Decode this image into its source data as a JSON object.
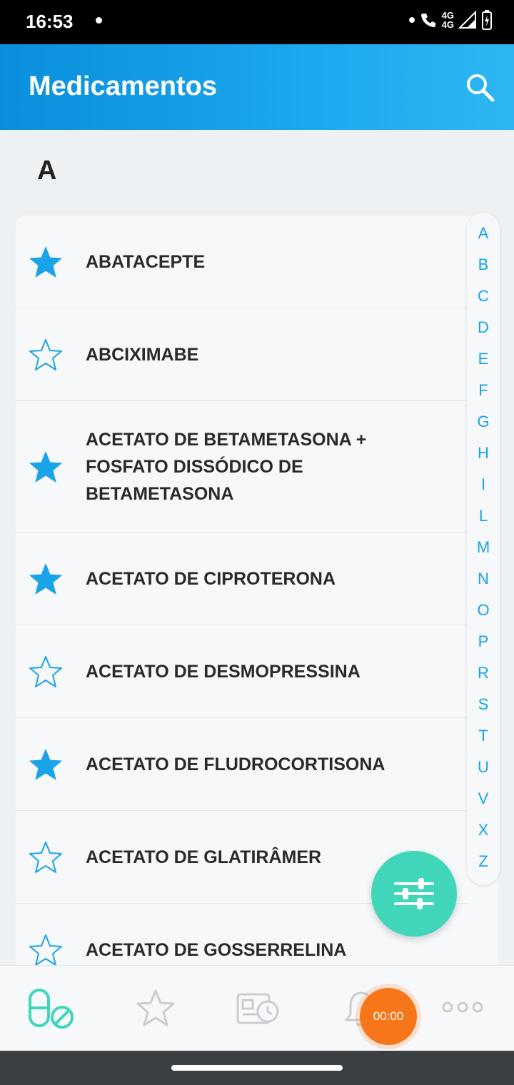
{
  "status_bar": {
    "time": "16:53",
    "network_1": "4G",
    "network_2": "4G"
  },
  "app_bar": {
    "title": "Medicamentos",
    "search_icon": "search-icon"
  },
  "section": {
    "letter": "A"
  },
  "medications": [
    {
      "lines": [
        "ABATACEPTE"
      ],
      "favorite": true
    },
    {
      "lines": [
        "ABCIXIMABE"
      ],
      "favorite": false
    },
    {
      "lines": [
        "ACETATO DE BETAMETASONA +",
        "FOSFATO DISSÓDICO DE",
        "BETAMETASONA"
      ],
      "favorite": true
    },
    {
      "lines": [
        "ACETATO DE CIPROTERONA"
      ],
      "favorite": true
    },
    {
      "lines": [
        "ACETATO DE DESMOPRESSINA"
      ],
      "favorite": false
    },
    {
      "lines": [
        "ACETATO DE FLUDROCORTISONA"
      ],
      "favorite": true
    },
    {
      "lines": [
        "ACETATO DE GLATIRÂMER"
      ],
      "favorite": false
    },
    {
      "lines": [
        "ACETATO DE GOSSERRELINA"
      ],
      "favorite": false
    }
  ],
  "alphabet_index": [
    "A",
    "B",
    "C",
    "D",
    "E",
    "F",
    "G",
    "H",
    "I",
    "L",
    "M",
    "N",
    "O",
    "P",
    "R",
    "S",
    "T",
    "U",
    "V",
    "X",
    "Z"
  ],
  "filter_fab": {
    "icon": "sliders-icon"
  },
  "bottom_nav": [
    {
      "id": "medications",
      "icon": "pill-icon",
      "active": true
    },
    {
      "id": "favorites",
      "icon": "star-outline-icon",
      "active": false
    },
    {
      "id": "history",
      "icon": "history-card-icon",
      "active": false
    },
    {
      "id": "reminders",
      "icon": "bell-icon",
      "active": false
    },
    {
      "id": "more",
      "icon": "more-dots-icon",
      "active": false
    }
  ],
  "timer": {
    "label": "00:00"
  },
  "colors": {
    "accent": "#1aa3e8",
    "fab": "#3fd6b9",
    "timer": "#f7761a",
    "active_nav": "#3fd6b9"
  }
}
